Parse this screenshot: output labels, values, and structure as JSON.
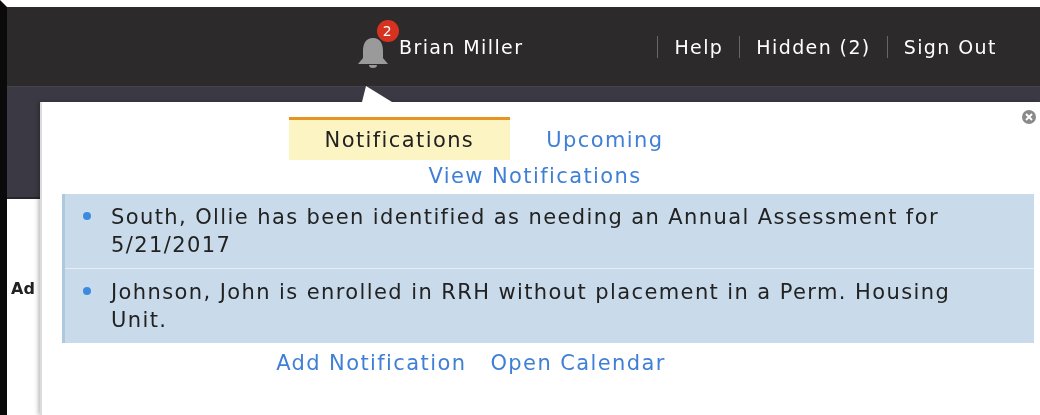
{
  "top_bar": {
    "notification_count": "2",
    "user_name": "Brian Miller",
    "links": [
      "Help",
      "Hidden (2)",
      "Sign Out"
    ]
  },
  "page": {
    "partial_text": "Ad"
  },
  "popup": {
    "tabs": [
      {
        "label": "Notifications",
        "selected": true
      },
      {
        "label": "Upcoming",
        "selected": false
      }
    ],
    "view_link": "View Notifications",
    "notifications": [
      {
        "text": "South, Ollie has been identified as needing an Annual Assessment for 5/21/2017"
      },
      {
        "text": "Johnson, John is enrolled in RRH without placement in a Perm. Housing Unit."
      }
    ],
    "footer_links": [
      "Add Notification",
      "Open Calendar"
    ]
  }
}
